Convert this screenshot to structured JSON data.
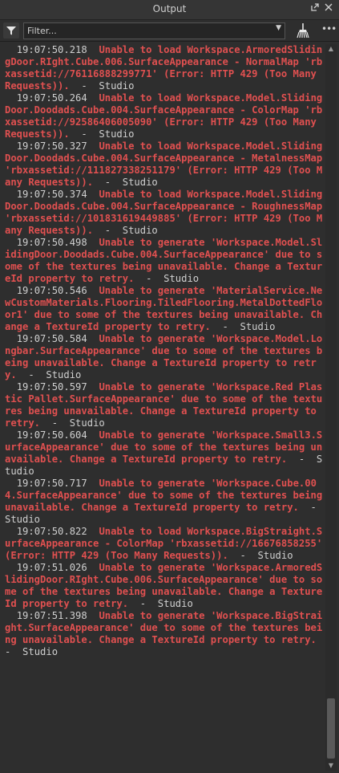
{
  "window": {
    "title": "Output",
    "undock_icon": "undock-icon",
    "close_icon": "close-icon"
  },
  "toolbar": {
    "filter_placeholder": "Filter...",
    "filter_icon": "filter-icon",
    "clear_icon": "broom-icon",
    "more_label": "•••"
  },
  "log": [
    {
      "time": "19:07:50.218",
      "message": "Unable to load Workspace.ArmoredSlidingDoor.RIght.Cube.006.SurfaceAppearance - NormalMap 'rbxassetid://76116888299771' (Error: HTTP 429 (Too Many Requests)).",
      "source": "Studio"
    },
    {
      "time": "19:07:50.264",
      "message": "Unable to load Workspace.Model.SlidingDoor.Doodads.Cube.004.SurfaceAppearance - ColorMap 'rbxassetid://92586406005090' (Error: HTTP 429 (Too Many Requests)).",
      "source": "Studio"
    },
    {
      "time": "19:07:50.327",
      "message": "Unable to load Workspace.Model.SlidingDoor.Doodads.Cube.004.SurfaceAppearance - MetalnessMap 'rbxassetid://111827338251179' (Error: HTTP 429 (Too Many Requests)).",
      "source": "Studio"
    },
    {
      "time": "19:07:50.374",
      "message": "Unable to load Workspace.Model.SlidingDoor.Doodads.Cube.004.SurfaceAppearance - RoughnessMap 'rbxassetid://101831619449885' (Error: HTTP 429 (Too Many Requests)).",
      "source": "Studio"
    },
    {
      "time": "19:07:50.498",
      "message": "Unable to generate 'Workspace.Model.SlidingDoor.Doodads.Cube.004.SurfaceAppearance' due to some of the textures being unavailable. Change a TextureId property to retry.",
      "source": "Studio"
    },
    {
      "time": "19:07:50.546",
      "message": "Unable to generate 'MaterialService.NewCustomMaterials.Flooring.TiledFlooring.MetalDottedFloor1' due to some of the textures being unavailable. Change a TextureId property to retry.",
      "source": "Studio"
    },
    {
      "time": "19:07:50.584",
      "message": "Unable to generate 'Workspace.Model.Longbar.SurfaceAppearance' due to some of the textures being unavailable. Change a TextureId property to retry.",
      "source": "Studio"
    },
    {
      "time": "19:07:50.597",
      "message": "Unable to generate 'Workspace.Red Plastic Pallet.SurfaceAppearance' due to some of the textures being unavailable. Change a TextureId property to retry.",
      "source": "Studio"
    },
    {
      "time": "19:07:50.604",
      "message": "Unable to generate 'Workspace.Small3.SurfaceAppearance' due to some of the textures being unavailable. Change a TextureId property to retry.",
      "source": "Studio"
    },
    {
      "time": "19:07:50.717",
      "message": "Unable to generate 'Workspace.Cube.004.SurfaceAppearance' due to some of the textures being unavailable. Change a TextureId property to retry.",
      "source": "Studio"
    },
    {
      "time": "19:07:50.822",
      "message": "Unable to load Workspace.BigStraight.SurfaceAppearance - ColorMap 'rbxassetid://16676858255' (Error: HTTP 429 (Too Many Requests)).",
      "source": "Studio"
    },
    {
      "time": "19:07:51.026",
      "message": "Unable to generate 'Workspace.ArmoredSlidingDoor.RIght.Cube.006.SurfaceAppearance' due to some of the textures being unavailable. Change a TextureId property to retry.",
      "source": "Studio"
    },
    {
      "time": "19:07:51.398",
      "message": "Unable to generate 'Workspace.BigStraight.SurfaceAppearance' due to some of the textures being unavailable. Change a TextureId property to retry.",
      "source": "Studio"
    }
  ],
  "colors": {
    "error_text": "#e05050",
    "normal_text": "#cfcfcf",
    "background": "#2e2e2e"
  }
}
